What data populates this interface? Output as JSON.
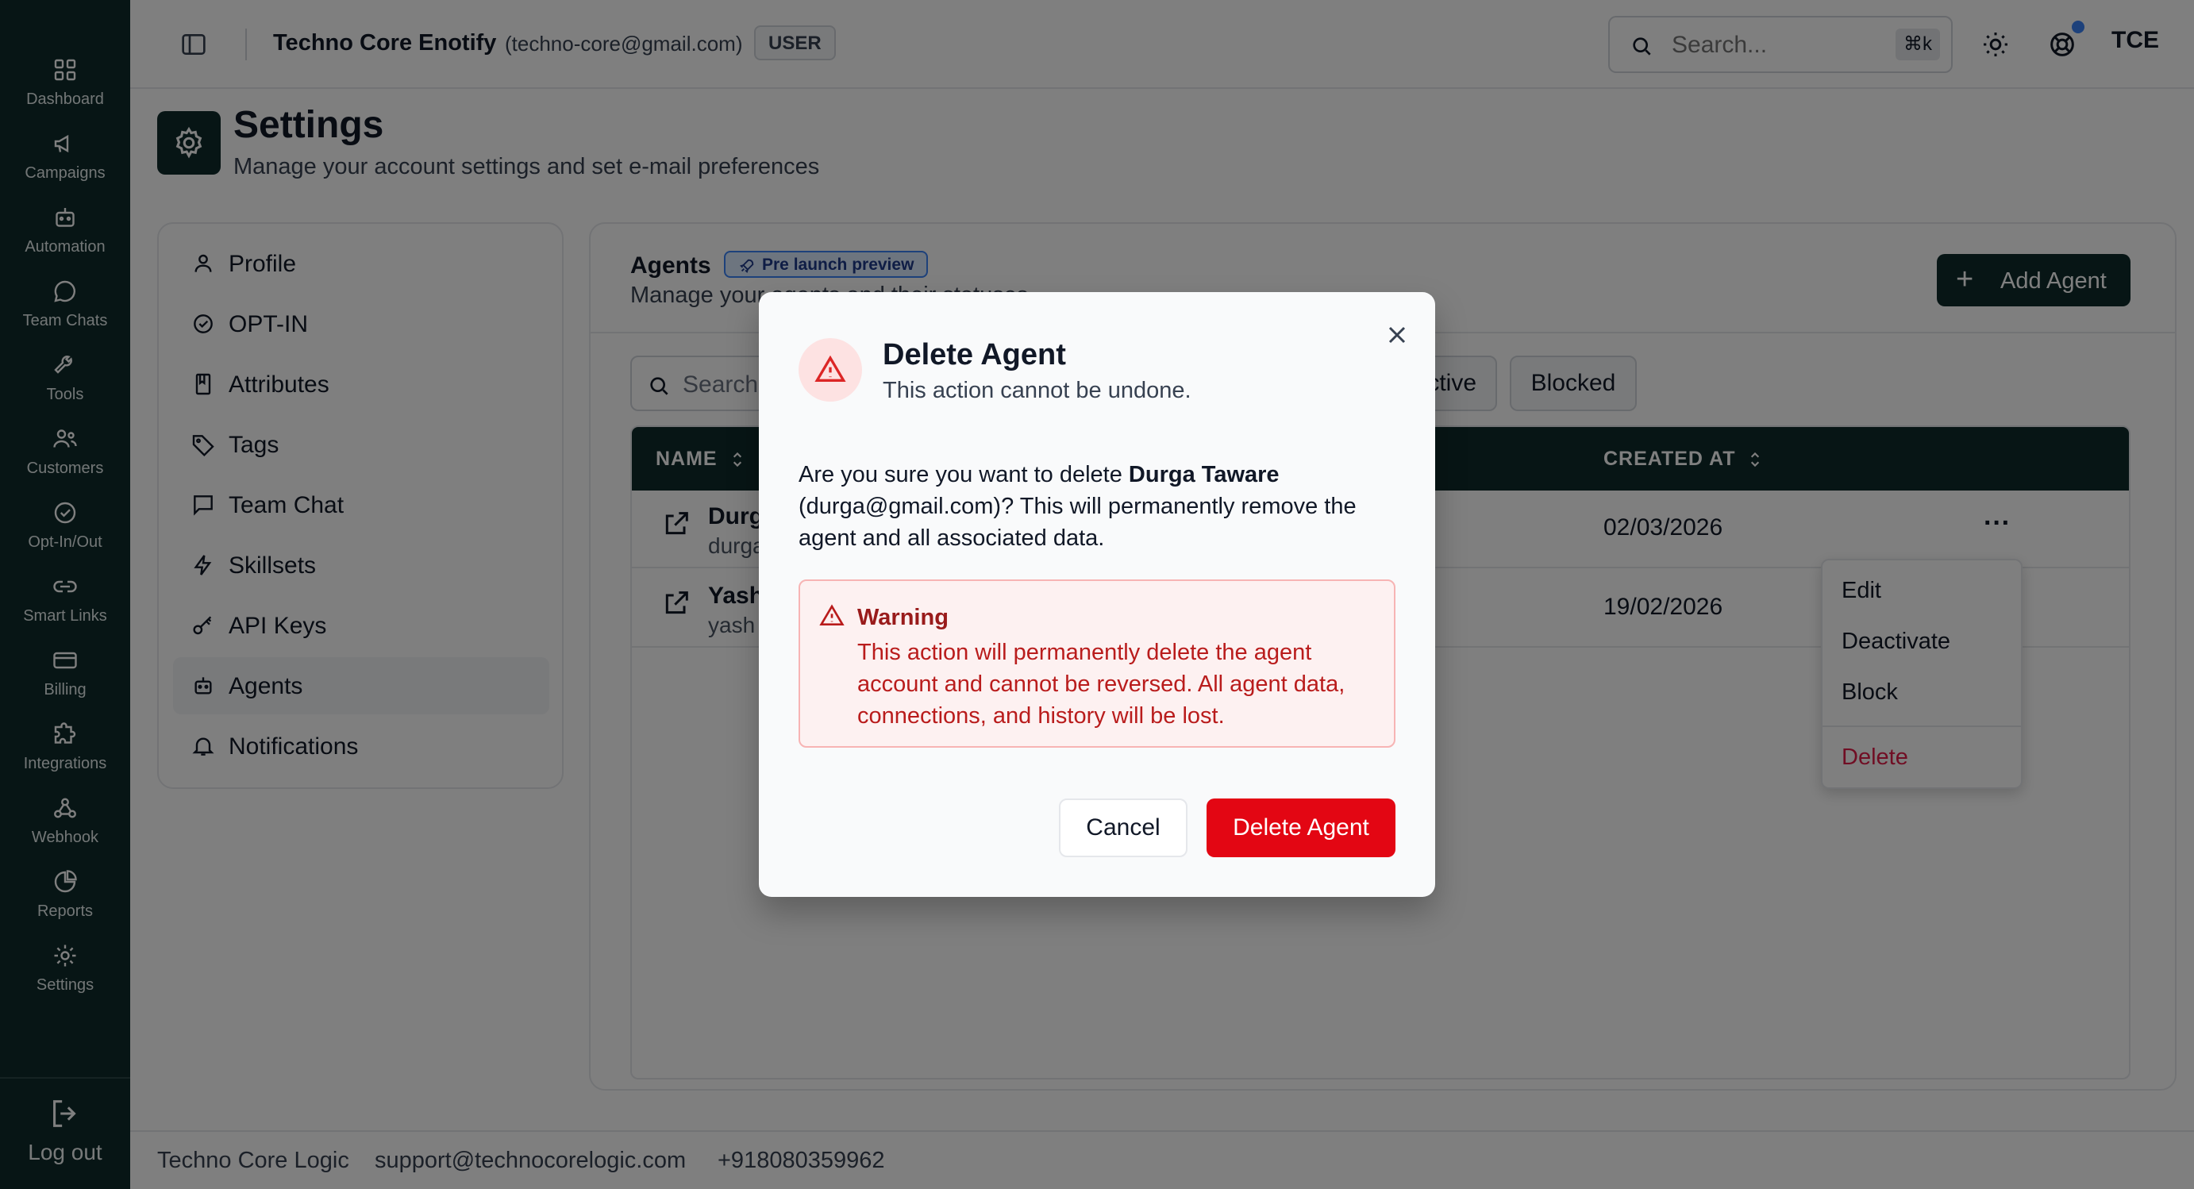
{
  "rail": {
    "items": [
      {
        "label": "Dashboard",
        "icon": "grid-icon"
      },
      {
        "label": "Campaigns",
        "icon": "megaphone-icon"
      },
      {
        "label": "Automation",
        "icon": "bot-icon"
      },
      {
        "label": "Team Chats",
        "icon": "chat-bubble-icon"
      },
      {
        "label": "Tools",
        "icon": "wrench-icon"
      },
      {
        "label": "Customers",
        "icon": "users-icon"
      },
      {
        "label": "Opt-In/Out",
        "icon": "check-circle-icon"
      },
      {
        "label": "Smart Links",
        "icon": "link-icon"
      },
      {
        "label": "Billing",
        "icon": "credit-card-icon"
      },
      {
        "label": "Integrations",
        "icon": "puzzle-icon"
      },
      {
        "label": "Webhook",
        "icon": "webhook-icon"
      },
      {
        "label": "Reports",
        "icon": "pie-chart-icon"
      },
      {
        "label": "Settings",
        "icon": "gear-icon"
      }
    ],
    "logout": "Log out"
  },
  "header": {
    "org_name": "Techno Core Enotify",
    "org_email": "(techno-core@gmail.com)",
    "role": "USER",
    "search_placeholder": "Search...",
    "shortcut": "⌘k",
    "avatar": "TCE"
  },
  "page": {
    "title": "Settings",
    "subtitle": "Manage your account settings and set e-mail preferences"
  },
  "settings_nav": {
    "items": [
      {
        "label": "Profile",
        "icon": "user-icon"
      },
      {
        "label": "OPT-IN",
        "icon": "check-circle-icon"
      },
      {
        "label": "Attributes",
        "icon": "bookmark-book-icon"
      },
      {
        "label": "Tags",
        "icon": "tag-icon"
      },
      {
        "label": "Team Chat",
        "icon": "message-square-icon"
      },
      {
        "label": "Skillsets",
        "icon": "zap-icon"
      },
      {
        "label": "API Keys",
        "icon": "key-icon"
      },
      {
        "label": "Agents",
        "icon": "bot-icon"
      },
      {
        "label": "Notifications",
        "icon": "bell-icon"
      }
    ],
    "active": "Agents"
  },
  "agents": {
    "title": "Agents",
    "badge": "Pre launch preview",
    "subtitle": "Manage your agents and their statuses",
    "add_button": "Add Agent",
    "search_placeholder": "Search",
    "filters": [
      "ctive",
      "Blocked"
    ],
    "columns": {
      "name": "NAME",
      "created": "CREATED AT"
    },
    "rows": [
      {
        "name": "Durg",
        "email": "durga",
        "created": "02/03/2026"
      },
      {
        "name": "Yash",
        "email": "yash",
        "created": "19/02/2026"
      }
    ],
    "row_menu": [
      "Edit",
      "Deactivate",
      "Block",
      "Delete"
    ]
  },
  "footer": {
    "company": "Techno Core Logic",
    "email": "support@technocorelogic.com",
    "phone": "+918080359962"
  },
  "modal": {
    "title": "Delete Agent",
    "subtitle": "This action cannot be undone.",
    "body_prefix": "Are you sure you want to delete ",
    "agent_name": "Durga Taware",
    "body_suffix": " (durga@gmail.com)? This will permanently remove the agent and all associated data.",
    "warning_title": "Warning",
    "warning_text": "This action will permanently delete the agent account and cannot be reversed. All agent data, connections, and history will be lost.",
    "cancel": "Cancel",
    "confirm": "Delete Agent"
  },
  "colors": {
    "rail_bg": "#0f2b2b",
    "danger": "#e30613",
    "badge_blue": "#3b82f6"
  }
}
